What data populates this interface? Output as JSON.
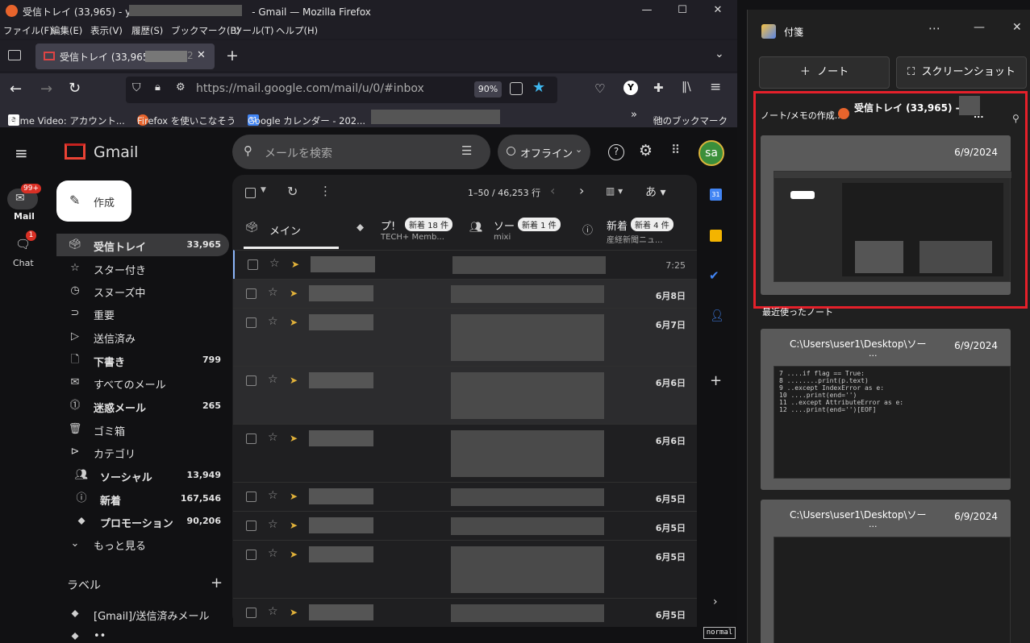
{
  "firefox": {
    "window_title": "受信トレイ (33,965) - y",
    "window_title_suffix": "- Gmail — Mozilla Firefox",
    "menu": [
      "ファイル(F)",
      "編集(E)",
      "表示(V)",
      "履歴(S)",
      "ブックマーク(B)",
      "ツール(T)",
      "ヘルプ(H)"
    ],
    "tab_title": "受信トレイ (33,965) -",
    "tab_suffix": "2",
    "url": "https://mail.google.com/mail/u/0/#inbox",
    "url_host": "mail.google.com",
    "zoom": "90%",
    "bookmarks": [
      "Prime Video: アカウント...",
      "Firefox を使いこなそう",
      "Google カレンダー - 202..."
    ],
    "other_bookmarks": "他のブックマーク"
  },
  "gmail": {
    "logo": "Gmail",
    "search_placeholder": "メールを検索",
    "status": "オフライン",
    "avatar": "sa",
    "compose": "作成",
    "rail": {
      "mail": "Mail",
      "mail_badge": "99+",
      "chat": "Chat",
      "chat_badge": "1"
    },
    "sidebar": [
      {
        "label": "受信トレイ",
        "count": "33,965",
        "bold": true
      },
      {
        "label": "スター付き",
        "count": ""
      },
      {
        "label": "スヌーズ中",
        "count": ""
      },
      {
        "label": "重要",
        "count": ""
      },
      {
        "label": "送信済み",
        "count": ""
      },
      {
        "label": "下書き",
        "count": "799",
        "bold": true
      },
      {
        "label": "すべてのメール",
        "count": ""
      },
      {
        "label": "迷惑メール",
        "count": "265",
        "bold": true
      },
      {
        "label": "ゴミ箱",
        "count": ""
      },
      {
        "label": "カテゴリ",
        "count": ""
      },
      {
        "label": "ソーシャル",
        "count": "13,949",
        "bold": true
      },
      {
        "label": "新着",
        "count": "167,546",
        "bold": true
      },
      {
        "label": "プロモーション",
        "count": "90,206",
        "bold": true
      },
      {
        "label": "もっと見る",
        "count": ""
      }
    ],
    "labels_header": "ラベル",
    "labels": [
      "[Gmail]/送信済みメール",
      "••"
    ],
    "toolbar": {
      "range": "1–50 / 46,253 行",
      "lang": "あ"
    },
    "tabs": [
      {
        "label": "メイン",
        "sub": "",
        "badge": ""
      },
      {
        "label": "プ!",
        "sub": "TECH+ Memb...",
        "badge": "新着 18 件"
      },
      {
        "label": "ソー",
        "sub": "mixi",
        "badge": "新着 1 件"
      },
      {
        "label": "新着",
        "sub": "産経新聞ニュ...",
        "badge": "新着 4 件"
      }
    ],
    "dates": [
      "7:25",
      "6月8日",
      "6月7日",
      "6月6日",
      "6月6日",
      "6月5日",
      "6月5日",
      "6月5日",
      "6月5日"
    ],
    "mode": "normal"
  },
  "notes": {
    "title": "付箋",
    "btn_note": "ノート",
    "btn_screenshot": "スクリーンショット",
    "source_label": "ノート/メモの作成...",
    "source_title": "受信トレイ (33,965) - y",
    "source_more": "...",
    "card1_date": "6/9/2024",
    "recent": "最近使ったノート",
    "card2_path": "C:\\Users\\user1\\Desktop\\ソー",
    "card2_more": "...",
    "card2_date": "6/9/2024",
    "card3_path": "C:\\Users\\user1\\Desktop\\ソー",
    "card3_more": "...",
    "card3_date": "6/9/2024",
    "code": [
      "7 ....if flag == True:",
      "8 ........print(p.text)",
      "9 ..except IndexError as e:",
      "10 ....print(end='')",
      "11 ..except AttributeError as e:",
      "12 ....print(end='')[EOF]"
    ]
  },
  "colors": {
    "accent_red": "#e5202a",
    "gmail_bg": "#111113",
    "notes_bg": "#202020"
  }
}
